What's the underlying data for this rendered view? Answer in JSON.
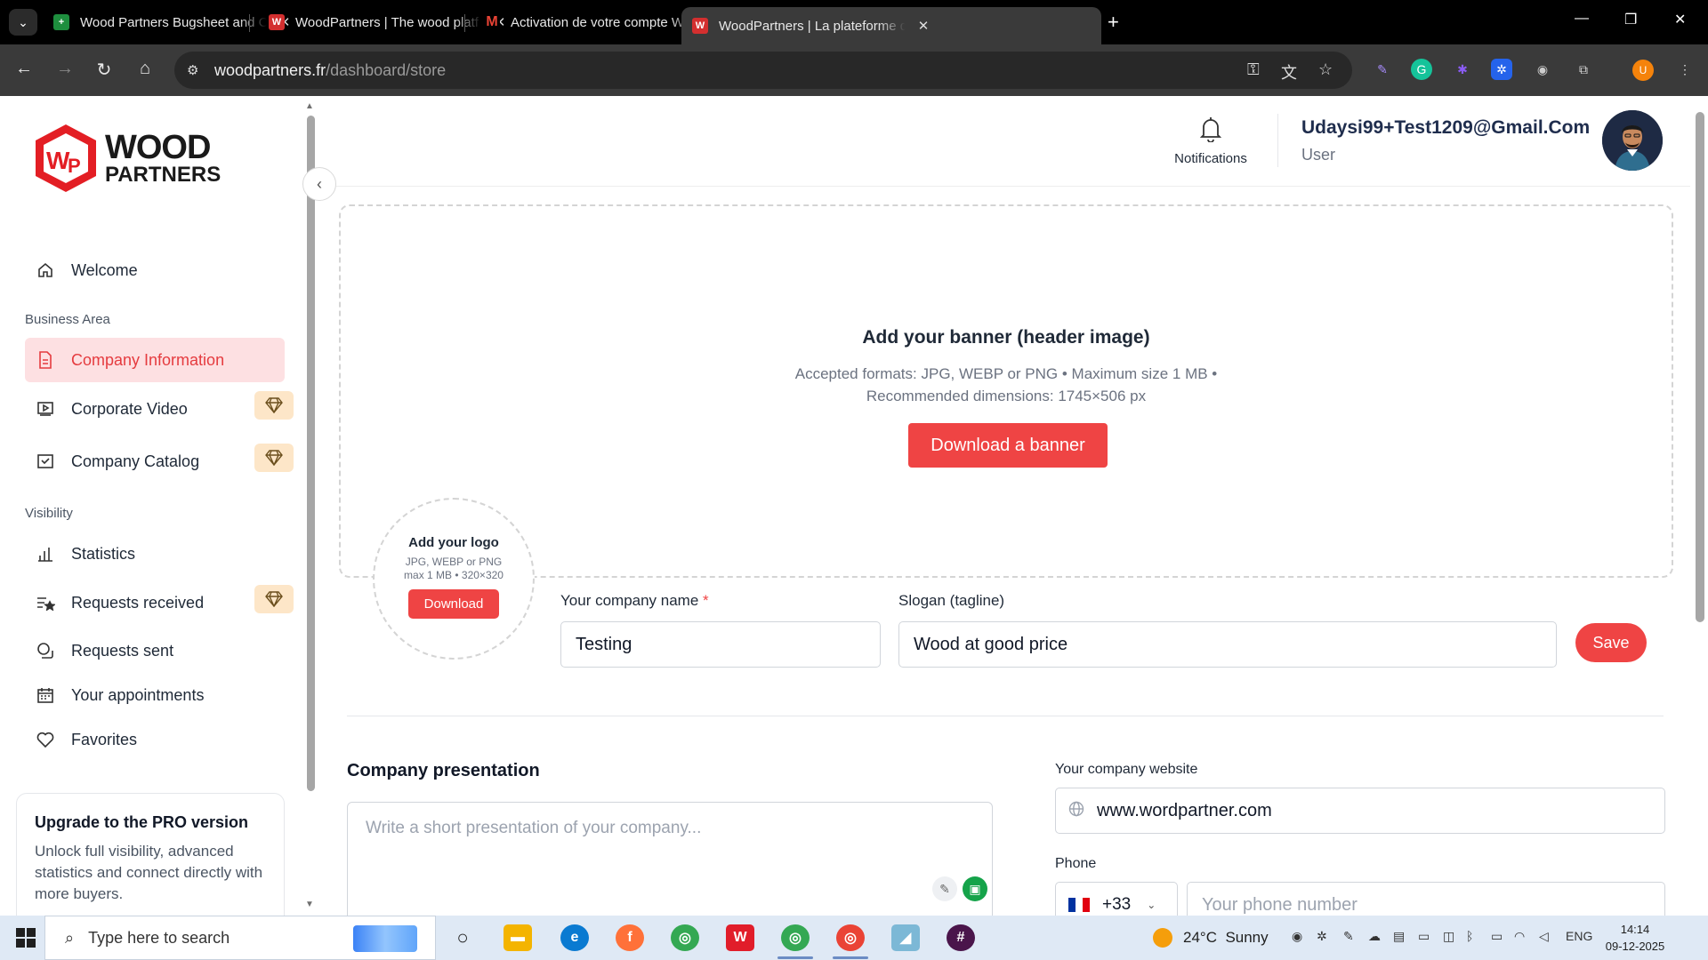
{
  "browser": {
    "tabs": [
      {
        "title": "Wood Partners Bugsheet and C",
        "favicon": "sheets-icon",
        "color": "#1e8e3e",
        "active": false
      },
      {
        "title": "WoodPartners | The wood platf",
        "favicon": "woodpartners-icon",
        "color": "#d32f2f",
        "active": false
      },
      {
        "title": "Activation de votre compte Wo",
        "favicon": "gmail-icon",
        "color": "#ea4335",
        "active": false
      },
      {
        "title": "WoodPartners | La plateforme d",
        "favicon": "woodpartners-icon",
        "color": "#d32f2f",
        "active": true
      }
    ],
    "url_host": "woodpartners.fr",
    "url_path": "/dashboard/store",
    "profile_initial": "U"
  },
  "sidebar": {
    "logo_line1": "WOOD",
    "logo_line2": "PARTNERS",
    "welcome": "Welcome",
    "section_business": "Business Area",
    "items_business": [
      {
        "label": "Company Information",
        "icon": "document-icon",
        "active": true,
        "pro": false
      },
      {
        "label": "Corporate Video",
        "icon": "video-icon",
        "active": false,
        "pro": true
      },
      {
        "label": "Company Catalog",
        "icon": "catalog-icon",
        "active": false,
        "pro": true
      }
    ],
    "section_visibility": "Visibility",
    "items_visibility": [
      {
        "label": "Statistics",
        "icon": "chart-icon",
        "pro": false
      },
      {
        "label": "Requests received",
        "icon": "requests-received-icon",
        "pro": true
      },
      {
        "label": "Requests sent",
        "icon": "requests-sent-icon",
        "pro": false
      },
      {
        "label": "Your appointments",
        "icon": "calendar-icon",
        "pro": false
      },
      {
        "label": "Favorites",
        "icon": "heart-icon",
        "pro": false
      }
    ],
    "upgrade": {
      "title": "Upgrade to the PRO version",
      "text": "Unlock full visibility, advanced statistics and connect directly with more buyers."
    }
  },
  "header": {
    "notifications_label": "Notifications",
    "user_email": "Udaysi99+Test1209@Gmail.Com",
    "user_role": "User"
  },
  "banner": {
    "title": "Add your banner (header image)",
    "info_line1": "Accepted formats: JPG, WEBP or PNG • Maximum size 1 MB •",
    "info_line2": "Recommended dimensions: 1745×506 px",
    "button": "Download a banner"
  },
  "logo_upload": {
    "title": "Add your logo",
    "line1": "JPG, WEBP or PNG",
    "line2": "max 1 MB • 320×320",
    "button": "Download"
  },
  "form": {
    "company_name_label": "Your company name",
    "required_mark": "*",
    "company_name_value": "Testing",
    "slogan_label": "Slogan (tagline)",
    "slogan_value": "Wood at good price",
    "save_button": "Save",
    "presentation_title": "Company presentation",
    "presentation_placeholder": "Write a short presentation of your company...",
    "website_label": "Your company website",
    "website_value": "www.wordpartner.com",
    "phone_label": "Phone",
    "phone_code": "+33",
    "phone_placeholder": "Your phone number"
  },
  "taskbar": {
    "search_placeholder": "Type here to search",
    "weather_temp": "24°C",
    "weather_desc": "Sunny",
    "language": "ENG",
    "time": "14:14",
    "date": "09-12-2025"
  },
  "colors": {
    "accent": "#ef4444",
    "active_bg": "#fde0e2",
    "pro_badge_bg": "#fde6c8"
  }
}
